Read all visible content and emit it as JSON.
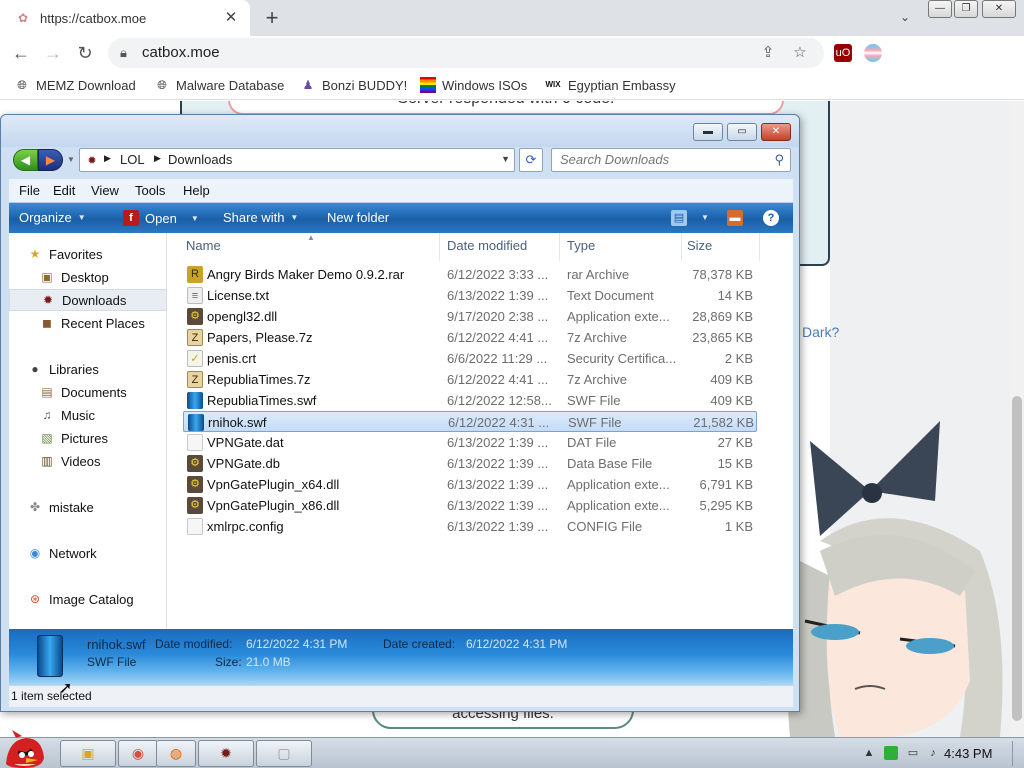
{
  "browser": {
    "tab_title": "https://catbox.moe",
    "url": "catbox.moe",
    "bookmarks": [
      {
        "label": "MEMZ Download",
        "icon": "globe-icon"
      },
      {
        "label": "Malware Database",
        "icon": "globe-icon"
      },
      {
        "label": "Bonzi BUDDY!",
        "icon": "bonzi-icon"
      },
      {
        "label": "Windows ISOs",
        "icon": "rainbow-flag-icon"
      },
      {
        "label": "Egyptian Embassy",
        "icon": "wix-icon"
      }
    ],
    "wix_text": "WIX"
  },
  "webpage": {
    "top_pill_text": "Server responded with 0 code.",
    "bottom_pill_text": "accessing files.",
    "dark_link": "Dark?"
  },
  "explorer": {
    "breadcrumbs": [
      "LOL",
      "Downloads"
    ],
    "search_placeholder": "Search Downloads",
    "menu": [
      "File",
      "Edit",
      "View",
      "Tools",
      "Help"
    ],
    "commands": {
      "organize": "Organize",
      "open": "Open",
      "share_with": "Share with",
      "new_folder": "New folder"
    },
    "nav": {
      "favorites": "Favorites",
      "desktop": "Desktop",
      "downloads": "Downloads",
      "recent_places": "Recent Places",
      "libraries": "Libraries",
      "documents": "Documents",
      "music": "Music",
      "pictures": "Pictures",
      "videos": "Videos",
      "mistake": "mistake",
      "network": "Network",
      "image_catalog": "Image Catalog"
    },
    "columns": {
      "name": "Name",
      "date": "Date modified",
      "type": "Type",
      "size": "Size"
    },
    "files": [
      {
        "name": "Angry Birds Maker Demo 0.9.2.rar",
        "date": "6/12/2022 3:33 ...",
        "type": "rar Archive",
        "size": "78,378 KB",
        "icon": "rar-icon",
        "selected": false
      },
      {
        "name": "License.txt",
        "date": "6/13/2022 1:39 ...",
        "type": "Text Document",
        "size": "14 KB",
        "icon": "text-icon",
        "selected": false
      },
      {
        "name": "opengl32.dll",
        "date": "9/17/2020 2:38 ...",
        "type": "Application exte...",
        "size": "28,869 KB",
        "icon": "dll-icon",
        "selected": false
      },
      {
        "name": "Papers, Please.7z",
        "date": "6/12/2022 4:41 ...",
        "type": "7z Archive",
        "size": "23,865 KB",
        "icon": "archive-icon",
        "selected": false
      },
      {
        "name": "penis.crt",
        "date": "6/6/2022 11:29 ...",
        "type": "Security Certifica...",
        "size": "2 KB",
        "icon": "certificate-icon",
        "selected": false
      },
      {
        "name": "RepubliaTimes.7z",
        "date": "6/12/2022 4:41 ...",
        "type": "7z Archive",
        "size": "409 KB",
        "icon": "archive-icon",
        "selected": false
      },
      {
        "name": "RepubliaTimes.swf",
        "date": "6/12/2022 12:58...",
        "type": "SWF File",
        "size": "409 KB",
        "icon": "swf-icon",
        "selected": false
      },
      {
        "name": "rnihok.swf",
        "date": "6/12/2022 4:31 ...",
        "type": "SWF File",
        "size": "21,582 KB",
        "icon": "swf-icon",
        "selected": true
      },
      {
        "name": "VPNGate.dat",
        "date": "6/13/2022 1:39 ...",
        "type": "DAT File",
        "size": "27 KB",
        "icon": "blank-file-icon",
        "selected": false
      },
      {
        "name": "VPNGate.db",
        "date": "6/13/2022 1:39 ...",
        "type": "Data Base File",
        "size": "15 KB",
        "icon": "dll-icon",
        "selected": false
      },
      {
        "name": "VpnGatePlugin_x64.dll",
        "date": "6/13/2022 1:39 ...",
        "type": "Application exte...",
        "size": "6,791 KB",
        "icon": "dll-icon",
        "selected": false
      },
      {
        "name": "VpnGatePlugin_x86.dll",
        "date": "6/13/2022 1:39 ...",
        "type": "Application exte...",
        "size": "5,295 KB",
        "icon": "dll-icon",
        "selected": false
      },
      {
        "name": "xmlrpc.config",
        "date": "6/13/2022 1:39 ...",
        "type": "CONFIG File",
        "size": "1 KB",
        "icon": "blank-file-icon",
        "selected": false
      }
    ],
    "details": {
      "name": "rnihok.swf",
      "type": "SWF File",
      "modified_label": "Date modified:",
      "modified_value": "6/12/2022 4:31 PM",
      "created_label": "Date created:",
      "created_value": "6/12/2022 4:31 PM",
      "size_label": "Size:",
      "size_value": "21.0 MB"
    },
    "status": "1 item selected"
  },
  "taskbar": {
    "clock": "4:43 PM",
    "pinned": [
      "explorer-icon",
      "chrome-icon",
      "firefox-icon",
      "app-icon",
      "blank-app-icon"
    ]
  },
  "colors": {
    "command_bar": "#1a5fa8",
    "selection": "#c4dcf7",
    "link": "#4a7cbf"
  }
}
